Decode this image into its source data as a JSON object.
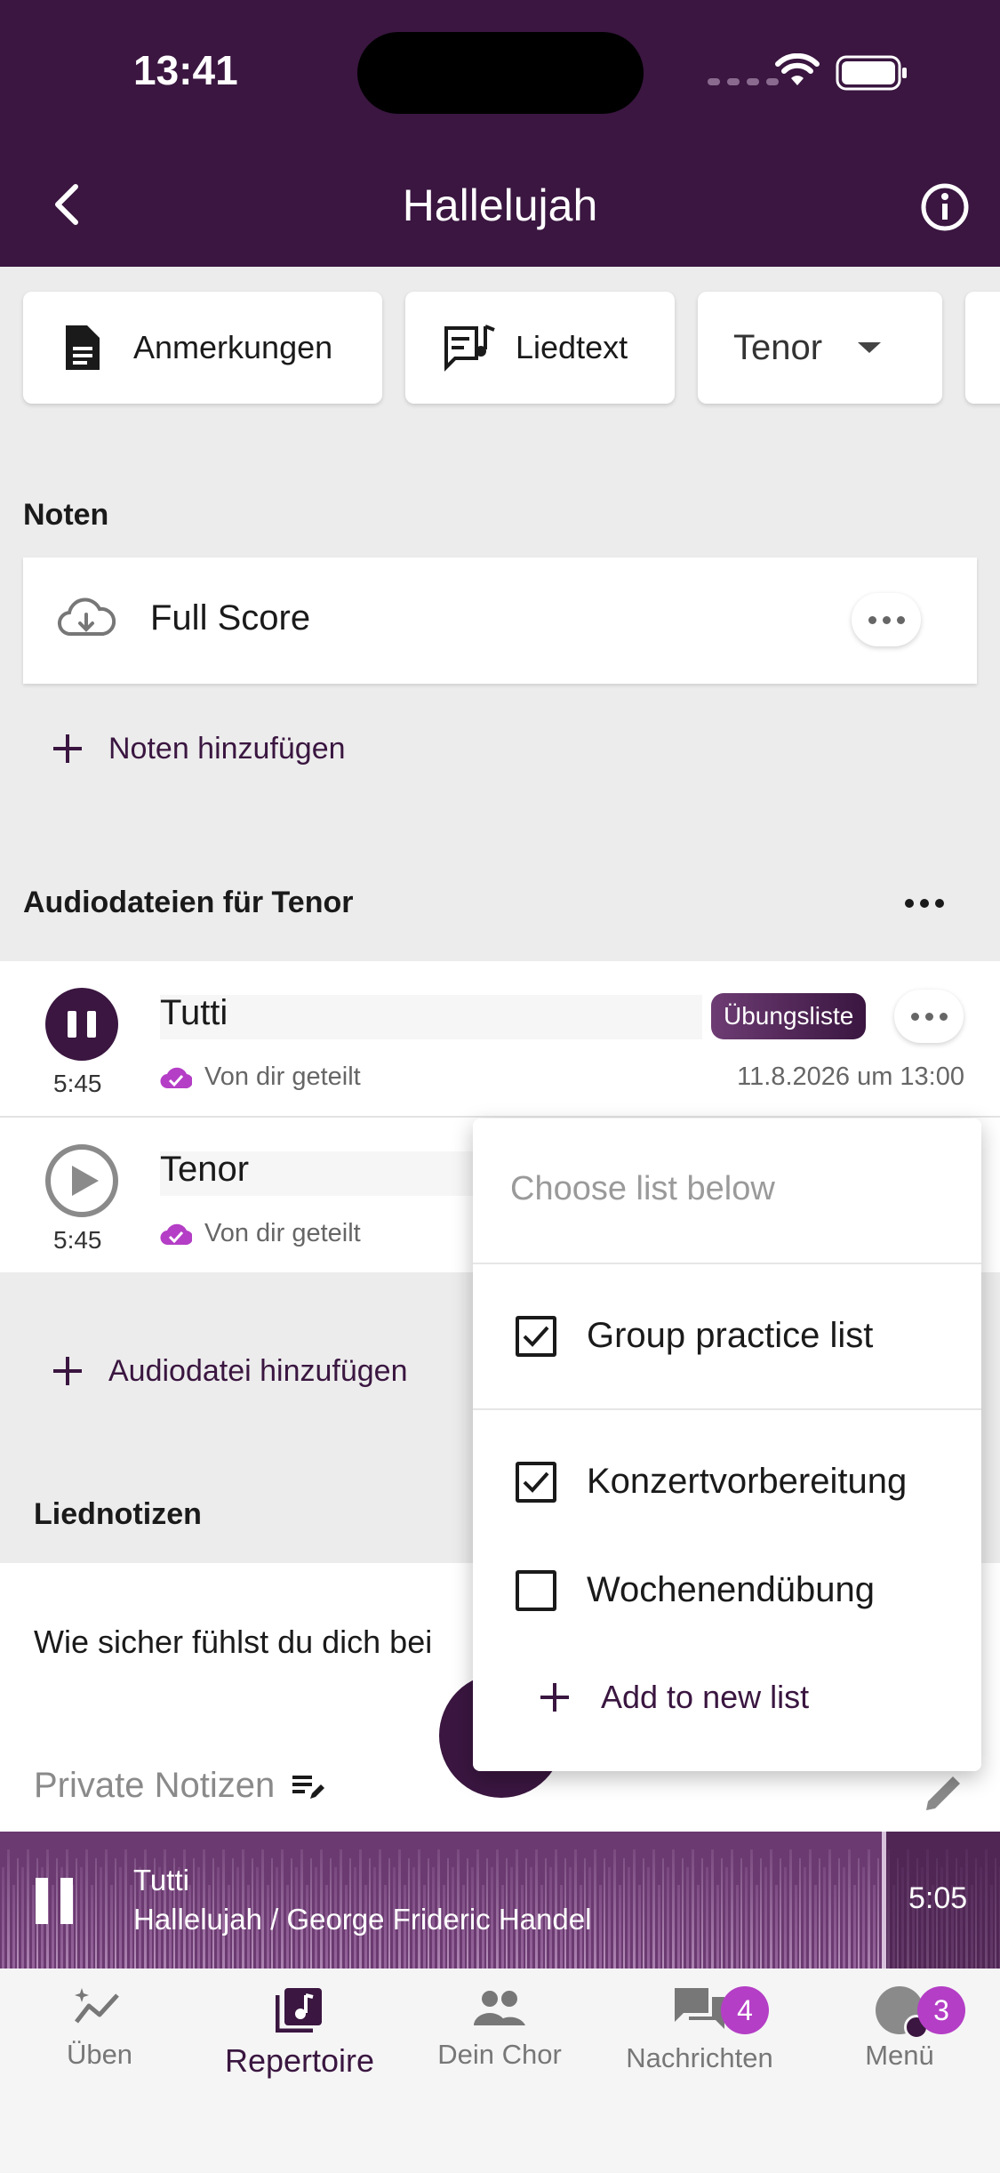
{
  "status_bar": {
    "time": "13:41"
  },
  "header": {
    "title": "Hallelujah"
  },
  "chips": {
    "notes": "Anmerkungen",
    "lyrics": "Liedtext",
    "voice": "Tenor"
  },
  "scores": {
    "section_title": "Noten",
    "items": [
      {
        "name": "Full Score"
      }
    ],
    "add_label": "Noten hinzufügen"
  },
  "audio": {
    "section_title": "Audiodateien für Tenor",
    "tracks": [
      {
        "name": "Tutti",
        "duration": "5:45",
        "shared": "Von dir geteilt",
        "badge": "Übungsliste",
        "date": "11.8.2026 um 13:00"
      },
      {
        "name": "Tenor",
        "duration": "5:45",
        "shared": "Von dir geteilt"
      }
    ],
    "add_label": "Audiodatei hinzufügen"
  },
  "song_notes": {
    "section_title": "Liednotizen",
    "question": "Wie sicher fühlst du dich bei",
    "private_label": "Private Notizen"
  },
  "list_menu": {
    "hint": "Choose list below",
    "items": [
      {
        "label": "Group practice list",
        "checked": true
      },
      {
        "label": "Konzertvorbereitung",
        "checked": true
      },
      {
        "label": "Wochenendübung",
        "checked": false
      }
    ],
    "add_label": "Add to new list"
  },
  "player": {
    "track": "Tutti",
    "subtitle": "Hallelujah / George Frideric Handel",
    "time": "5:05"
  },
  "tabbar": {
    "items": [
      {
        "label": "Üben"
      },
      {
        "label": "Repertoire"
      },
      {
        "label": "Dein Chor"
      },
      {
        "label": "Nachrichten",
        "badge": "4"
      },
      {
        "label": "Menü",
        "badge": "3"
      }
    ]
  },
  "colors": {
    "brand": "#3a1640",
    "accent": "#b43ec6",
    "background": "#ececec"
  }
}
